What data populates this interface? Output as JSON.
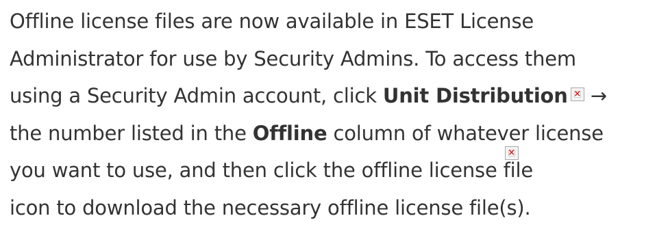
{
  "paragraph": {
    "line1": "Offline license files are now available in ESET License",
    "line2": "Administrator for use by Security Admins. To access them",
    "line3_pre": "using a Security Admin account, click ",
    "line3_bold": "Unit Distribution",
    "line3_arrow": " →",
    "line4_pre": "the number listed in the ",
    "line4_bold": "Offline",
    "line4_post": " column of whatever license",
    "line5_pre": "you want to use, and then click the offline license ",
    "line5_post": "fi",
    "line5_e": "le",
    "line6": "icon  to download the necessary offline license file(s)."
  },
  "icons": {
    "unit_distribution": "broken-image-icon",
    "offline_license_file": "broken-image-icon",
    "broken_mark": "×",
    "broken_color": "#d62020"
  }
}
